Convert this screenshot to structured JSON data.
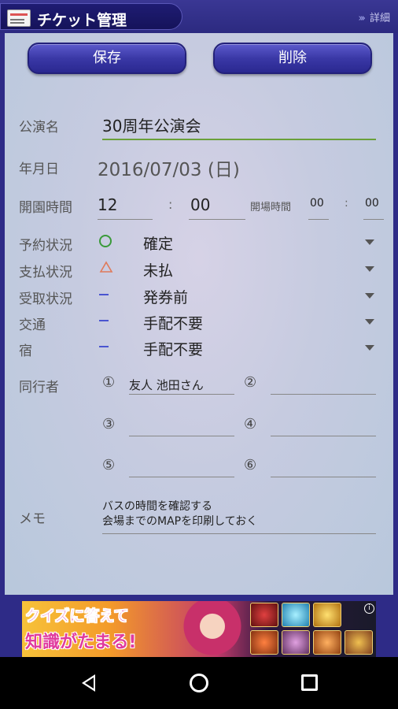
{
  "header": {
    "title": "チケット管理",
    "detail_label": "詳細",
    "detail_chevrons": "›››"
  },
  "toolbar": {
    "save_label": "保存",
    "delete_label": "削除"
  },
  "form": {
    "performance_label": "公演名",
    "performance_value": "30周年公演会",
    "date_label": "年月日",
    "date_value": "2016/07/03 (日)",
    "open_label": "開園時間",
    "open_hour": "12",
    "open_minute": "00",
    "time_sep": ":",
    "venue_open_label": "開場時間",
    "venue_hour": "00",
    "venue_minute": "00",
    "statuses": [
      {
        "label": "予約状況",
        "icon": "circle-icon",
        "value": "確定"
      },
      {
        "label": "支払状況",
        "icon": "triangle-icon",
        "value": "未払"
      },
      {
        "label": "受取状況",
        "icon": "dash-icon",
        "value": "発券前"
      },
      {
        "label": "交通",
        "icon": "dash-icon",
        "value": "手配不要"
      },
      {
        "label": "宿",
        "icon": "dash-icon",
        "value": "手配不要"
      }
    ],
    "companions_label": "同行者",
    "companions": [
      {
        "num": "①",
        "value": "友人 池田さん"
      },
      {
        "num": "②",
        "value": ""
      },
      {
        "num": "③",
        "value": ""
      },
      {
        "num": "④",
        "value": ""
      },
      {
        "num": "⑤",
        "value": ""
      },
      {
        "num": "⑥",
        "value": ""
      }
    ],
    "memo_label": "メモ",
    "memo_line1": "バスの時間を確認する",
    "memo_line2": "会場までのMAPを印刷しておく"
  },
  "ad": {
    "line1": "クイズに答えて",
    "line2": "知識がたまる!",
    "info": "i"
  },
  "colors": {
    "accent": "#2e2b87",
    "button": "#3a38a6",
    "status_circle": "#3a9a3a",
    "status_triangle": "#e07a5a",
    "status_dash": "#4a55d0"
  }
}
